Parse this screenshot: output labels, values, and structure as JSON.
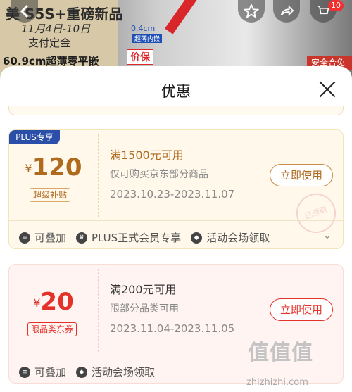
{
  "background": {
    "banner_line1": "美 S5S+重磅新品",
    "banner_line2": "11月4日-10日",
    "banner_line3": "支付定金",
    "banner_line4": "60.9cm超薄零平嵌",
    "measure": "0.4cm",
    "measure_note": "超薄内嵌",
    "price_label": "价保",
    "right_box": "安全合免",
    "cart_count": "10",
    "back_icon": "chevron-left-icon",
    "favorite_icon": "star-icon",
    "share_icon": "share-icon"
  },
  "sheet": {
    "title": "优惠",
    "close_icon": "close-icon"
  },
  "coupons": [
    {
      "tag": "PLUS专享",
      "currency": "¥",
      "amount": "120",
      "type": "超级补贴",
      "condition": "满1500元可用",
      "scope": "仅可购买京东部分商品",
      "dates": "2023.10.23-2023.11.07",
      "button": "立即使用",
      "stamp": "已领取",
      "features": [
        "可叠加",
        "PLUS正式会员专享",
        "活动会场领取"
      ],
      "color": "#b06a1e"
    },
    {
      "currency": "¥",
      "amount": "20",
      "type": "限品类东券",
      "condition": "满200元可用",
      "scope": "限部分品类可用",
      "dates": "2023.11.04-2023.11.05",
      "button": "立即使用",
      "features": [
        "可叠加",
        "活动会场领取"
      ],
      "color": "#e2322a"
    }
  ],
  "watermark": {
    "logo": "值值值",
    "url": "zhizhizhi.com"
  }
}
